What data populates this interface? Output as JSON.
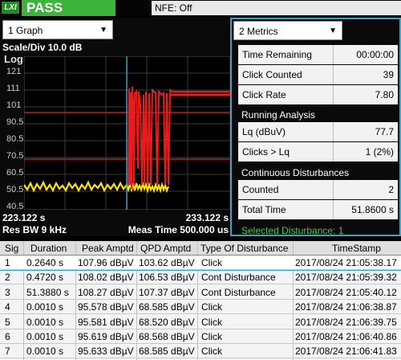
{
  "status": {
    "logo": "LXI",
    "verdict": "PASS",
    "nfe": "NFE: Off"
  },
  "graph_panel": {
    "dropdown_label": "1 Graph",
    "scale_div": "Scale/Div 10.0 dB",
    "log_label": "Log",
    "y_ticks": [
      "121",
      "111",
      "101",
      "90.5",
      "80.5",
      "70.5",
      "60.5",
      "50.5",
      "40.5"
    ],
    "start_time": "223.122 s",
    "end_time": "233.122 s",
    "res_bw": "Res BW 9 kHz",
    "meas_time": "Meas Time 500.000 us"
  },
  "metrics_panel": {
    "dropdown_label": "2 Metrics",
    "rows": [
      {
        "label": "Time Remaining",
        "value": "00:00:00"
      },
      {
        "label": "Click Counted",
        "value": "39"
      },
      {
        "label": "Click Rate",
        "value": "7.80"
      }
    ],
    "running_title": "Running Analysis",
    "running_rows": [
      {
        "label": "Lq (dBuV)",
        "value": "77.7"
      },
      {
        "label": "Clicks > Lq",
        "value": "1 (2%)"
      }
    ],
    "continuous_title": "Continuous Disturbances",
    "continuous_rows": [
      {
        "label": "Counted",
        "value": "2"
      },
      {
        "label": "Total Time",
        "value": "51.8600 s"
      }
    ],
    "selected": "Selected Disturbance: 1"
  },
  "table": {
    "headers": [
      "Sig",
      "Duration",
      "Peak Amptd",
      "QPD Amptd",
      "Type Of Disturbance",
      "TimeStamp"
    ],
    "rows": [
      [
        "1",
        "0.2640 s",
        "107.96 dBµV",
        "103.62 dBµV",
        "Click",
        "2017/08/24 21:05:38.17"
      ],
      [
        "2",
        "0.4720 s",
        "108.02 dBµV",
        "106.53 dBµV",
        "Cont Disturbance",
        "2017/08/24 21:05:39.32"
      ],
      [
        "3",
        "51.3880 s",
        "108.27 dBµV",
        "107.37 dBµV",
        "Cont Disturbance",
        "2017/08/24 21:05:40.12"
      ],
      [
        "4",
        "0.0010 s",
        "95.578 dBµV",
        "68.585 dBµV",
        "Click",
        "2017/08/24 21:06:38.87"
      ],
      [
        "5",
        "0.0010 s",
        "95.581 dBµV",
        "68.520 dBµV",
        "Click",
        "2017/08/24 21:06:39.75"
      ],
      [
        "6",
        "0.0010 s",
        "95.619 dBµV",
        "68.568 dBµV",
        "Click",
        "2017/08/24 21:06:40.86"
      ],
      [
        "7",
        "0.0010 s",
        "95.633 dBµV",
        "68.585 dBµV",
        "Click",
        "2017/08/24 21:06:41.83"
      ]
    ],
    "selected_row": 0
  },
  "colors": {
    "pass": "#3cb43c",
    "accent": "#39a2c8",
    "trace_yellow": "#ffe400",
    "trace_red": "#e81c1c",
    "selected_text": "#3ccf3c"
  }
}
